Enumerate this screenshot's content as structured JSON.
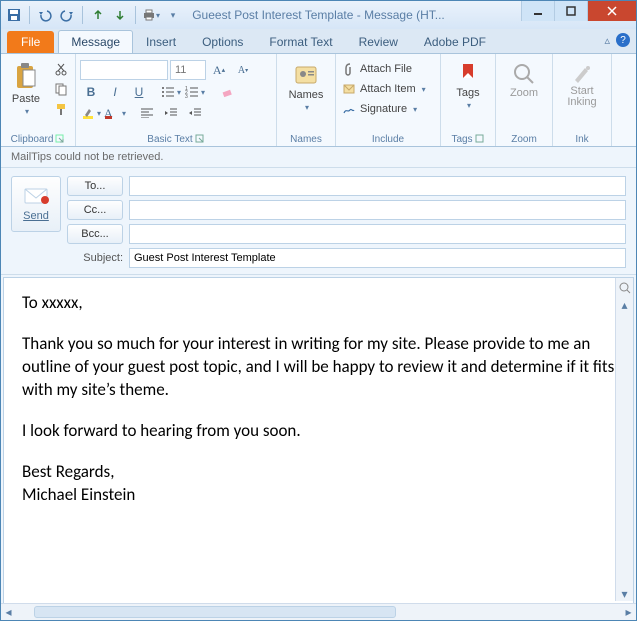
{
  "window": {
    "title": "Gueest Post Interest Template - Message (HT..."
  },
  "tabs": {
    "file": "File",
    "items": [
      "Message",
      "Insert",
      "Options",
      "Format Text",
      "Review",
      "Adobe PDF"
    ],
    "active_index": 0
  },
  "ribbon": {
    "clipboard": {
      "label": "Clipboard",
      "paste": "Paste"
    },
    "basic_text": {
      "label": "Basic Text",
      "font_name": "",
      "font_size": "11"
    },
    "names": {
      "label": "Names",
      "names_btn": "Names"
    },
    "include": {
      "label": "Include",
      "attach_file": "Attach File",
      "attach_item": "Attach Item",
      "signature": "Signature"
    },
    "tags": {
      "label": "Tags",
      "tags_btn": "Tags"
    },
    "zoom": {
      "label": "Zoom",
      "zoom_btn": "Zoom"
    },
    "ink": {
      "label": "Ink",
      "ink_btn": "Start\nInking"
    }
  },
  "mailtips": "MailTips could not be retrieved.",
  "envelope": {
    "send": "Send",
    "to_label": "To...",
    "cc_label": "Cc...",
    "bcc_label": "Bcc...",
    "subject_label": "Subject:",
    "to_value": "",
    "cc_value": "",
    "bcc_value": "",
    "subject_value": "Guest Post Interest Template"
  },
  "body": {
    "greeting": "To xxxxx,",
    "p1": "Thank you so much for your interest in writing for my site. Please provide to me an outline of your guest post topic, and I will be happy to review it and determine if it fits with my site’s theme.",
    "p2": "I look forward to hearing from you soon.",
    "closing": "Best Regards,",
    "signature": "Michael Einstein"
  }
}
